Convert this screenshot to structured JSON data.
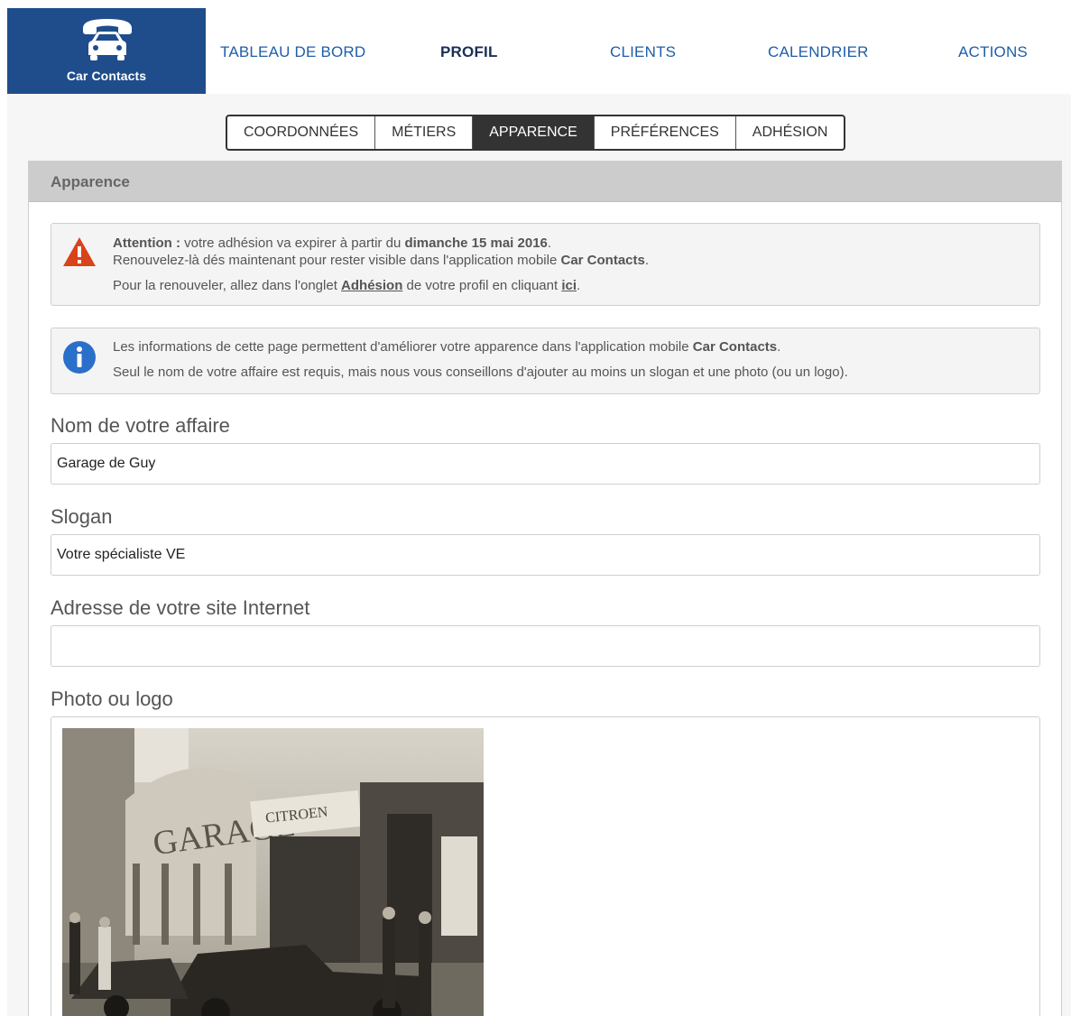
{
  "app": {
    "name": "Car Contacts"
  },
  "nav": {
    "items": [
      {
        "label": "TABLEAU DE BORD",
        "active": false
      },
      {
        "label": "PROFIL",
        "active": true
      },
      {
        "label": "CLIENTS",
        "active": false
      },
      {
        "label": "CALENDRIER",
        "active": false
      },
      {
        "label": "ACTIONS",
        "active": false
      }
    ]
  },
  "subtabs": {
    "items": [
      {
        "label": "COORDONNÉES",
        "active": false
      },
      {
        "label": "MÉTIERS",
        "active": false
      },
      {
        "label": "APPARENCE",
        "active": true
      },
      {
        "label": "PRÉFÉRENCES",
        "active": false
      },
      {
        "label": "ADHÉSION",
        "active": false
      }
    ]
  },
  "panel": {
    "title": "Apparence",
    "warning": {
      "strong_prefix": "Attention :",
      "line1_a": " votre adhésion va expirer à partir du ",
      "line1_date": "dimanche 15 mai 2016",
      "line1_end": ".",
      "line2_a": "Renouvelez-là dés maintenant pour rester visible dans l'application mobile ",
      "line2_app": "Car Contacts",
      "line2_end": ".",
      "line3_a": "Pour la renouveler, allez dans l'onglet ",
      "line3_link": "Adhésion",
      "line3_b": " de votre profil en cliquant ",
      "line3_link2": "ici",
      "line3_end": "."
    },
    "info": {
      "line1_a": "Les informations de cette page permettent d'améliorer votre apparence dans l'application mobile ",
      "line1_app": "Car Contacts",
      "line1_end": ".",
      "line2": "Seul le nom de votre affaire est requis, mais nous vous conseillons d'ajouter au moins un slogan et une photo (ou un logo)."
    },
    "fields": {
      "business_name_label": "Nom de votre affaire",
      "business_name_value": "Garage de Guy",
      "slogan_label": "Slogan",
      "slogan_value": "Votre spécialiste VE",
      "website_label": "Adresse de votre site Internet",
      "website_value": "",
      "photo_label": "Photo ou logo"
    }
  },
  "colors": {
    "brand": "#1f4d8c",
    "nav_link": "#1f5ea8",
    "warning": "#d9431a",
    "info": "#2a6fc9"
  }
}
